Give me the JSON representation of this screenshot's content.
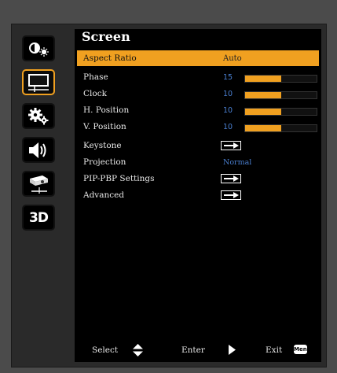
{
  "menu": {
    "title": "Screen",
    "tabs": [
      {
        "name": "image-tab",
        "icon": "brightness-icon",
        "selected": false
      },
      {
        "name": "screen-tab",
        "icon": "screen-icon",
        "selected": true
      },
      {
        "name": "settings-tab",
        "icon": "gears-icon",
        "selected": false
      },
      {
        "name": "volume-tab",
        "icon": "speaker-icon",
        "selected": false
      },
      {
        "name": "projector-tab",
        "icon": "projector-icon",
        "selected": false
      },
      {
        "name": "3d-tab",
        "icon": "3d-icon",
        "label": "3D",
        "selected": false
      }
    ],
    "items": [
      {
        "label": "Aspect Ratio",
        "value": "Auto",
        "type": "text",
        "highlighted": true
      },
      {
        "label": "Phase",
        "value": "15",
        "type": "slider",
        "level": 0.5
      },
      {
        "label": "Clock",
        "value": "10",
        "type": "slider",
        "level": 0.5
      },
      {
        "label": "H. Position",
        "value": "10",
        "type": "slider",
        "level": 0.5
      },
      {
        "label": "V. Position",
        "value": "10",
        "type": "slider",
        "level": 0.5
      },
      {
        "label": "Keystone",
        "type": "enter",
        "icon": "enter-arrow-icon"
      },
      {
        "label": "Projection",
        "value": "Normal",
        "type": "text"
      },
      {
        "label": "PIP-PBP Settings",
        "type": "enter",
        "icon": "enter-arrow-icon"
      },
      {
        "label": "Advanced",
        "type": "enter",
        "icon": "enter-arrow-icon"
      }
    ],
    "footer": {
      "select_label": "Select",
      "enter_label": "Enter",
      "exit_label": "Exit",
      "menu_key": "Menu"
    },
    "colors": {
      "accent": "#f0a020",
      "value_blue": "#4a7fd0",
      "panel_bg": "#000000"
    }
  }
}
